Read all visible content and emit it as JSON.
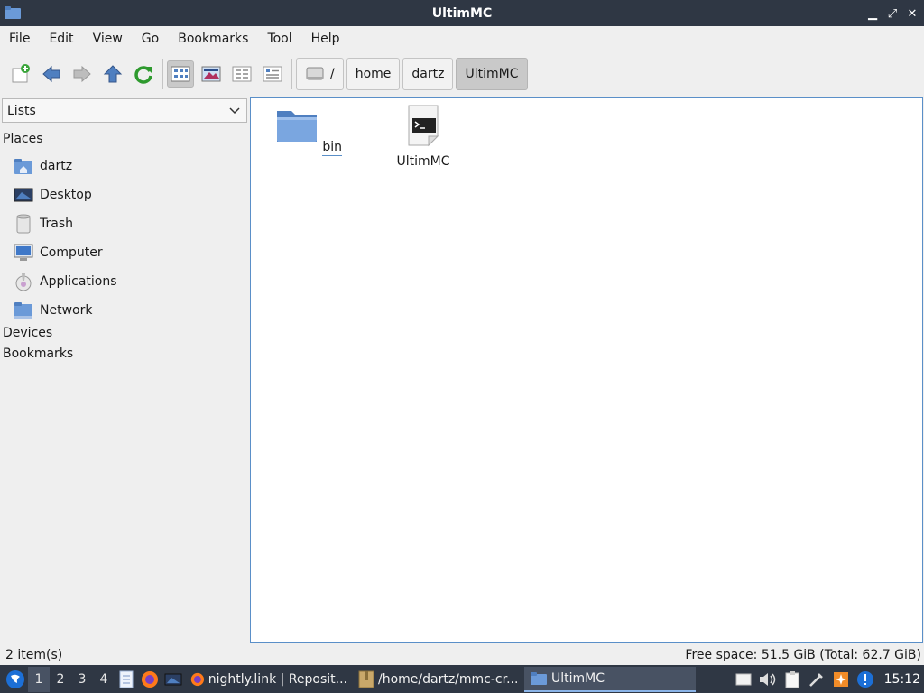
{
  "window": {
    "title": "UltimMC",
    "controls": {
      "minimize": "▁",
      "maximize": "⤢",
      "close": "✕"
    }
  },
  "menubar": {
    "items": [
      "File",
      "Edit",
      "View",
      "Go",
      "Bookmarks",
      "Tool",
      "Help"
    ]
  },
  "toolbar": {
    "buttons": [
      "new-tab-icon",
      "back-icon",
      "forward-icon",
      "up-icon",
      "reload-icon",
      "icon-view-icon",
      "thumbnail-view-icon",
      "compact-view-icon",
      "detailed-view-icon"
    ],
    "path": [
      "/",
      "home",
      "dartz",
      "UltimMC"
    ]
  },
  "sidebar": {
    "selector": "Lists",
    "places_header": "Places",
    "places": [
      {
        "label": "dartz",
        "icon": "home-folder-icon"
      },
      {
        "label": "Desktop",
        "icon": "desktop-icon"
      },
      {
        "label": "Trash",
        "icon": "trash-icon"
      },
      {
        "label": "Computer",
        "icon": "computer-icon"
      },
      {
        "label": "Applications",
        "icon": "applications-icon"
      },
      {
        "label": "Network",
        "icon": "network-icon"
      }
    ],
    "devices_header": "Devices",
    "bookmarks_header": "Bookmarks"
  },
  "files": [
    {
      "name": "bin",
      "icon": "folder-icon"
    },
    {
      "name": "UltimMC",
      "icon": "executable-script-icon"
    }
  ],
  "status": {
    "count": "2 item(s)",
    "free_space": "Free space: 51.5 GiB (Total: 62.7 GiB)"
  },
  "panel": {
    "workspaces": [
      "1",
      "2",
      "3",
      "4"
    ],
    "active_workspace": "1",
    "tasks": [
      {
        "label": "nightly.link | Reposit...",
        "icon": "firefox-icon"
      },
      {
        "label": "/home/dartz/mmc-cr...",
        "icon": "archive-icon"
      },
      {
        "label": "UltimMC",
        "icon": "folder-icon"
      }
    ],
    "clock": "15:12"
  },
  "colors": {
    "titlebar": "#2f3744",
    "accent": "#5a8fc8",
    "folder": "#6b9ad8"
  }
}
